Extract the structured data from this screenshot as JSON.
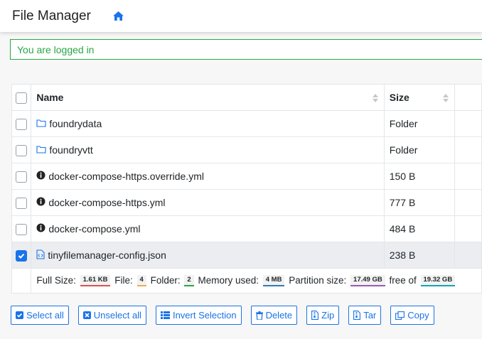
{
  "header": {
    "title": "File Manager",
    "icon": "home-icon",
    "accent": "#1a73e8"
  },
  "alert": {
    "text": "You are logged in",
    "color": "#28a745"
  },
  "table": {
    "columns": [
      "Name",
      "Size"
    ],
    "rows": [
      {
        "name": "foundrydata",
        "size": "Folder",
        "icon": "folder-icon",
        "checked": false
      },
      {
        "name": "foundryvtt",
        "size": "Folder",
        "icon": "folder-icon",
        "checked": false
      },
      {
        "name": "docker-compose-https.override.yml",
        "size": "150 B",
        "icon": "info-circle-icon",
        "checked": false
      },
      {
        "name": "docker-compose-https.yml",
        "size": "777 B",
        "icon": "info-circle-icon",
        "checked": false
      },
      {
        "name": "docker-compose.yml",
        "size": "484 B",
        "icon": "info-circle-icon",
        "checked": false
      },
      {
        "name": "tinyfilemanager-config.json",
        "size": "238 B",
        "icon": "code-file-icon",
        "checked": true
      }
    ]
  },
  "footer": {
    "full_size_label": "Full Size:",
    "full_size": "1.61 KB",
    "file_label": "File:",
    "file_count": "4",
    "folder_label": "Folder:",
    "folder_count": "2",
    "memory_label": "Memory used:",
    "memory": "4 MB",
    "partition_label": "Partition size:",
    "partition": "17.49 GB",
    "free_label": "free of",
    "total": "19.32 GB"
  },
  "buttons": {
    "select_all": "Select all",
    "unselect_all": "Unselect all",
    "invert_selection": "Invert Selection",
    "delete": "Delete",
    "zip": "Zip",
    "tar": "Tar",
    "copy": "Copy"
  }
}
